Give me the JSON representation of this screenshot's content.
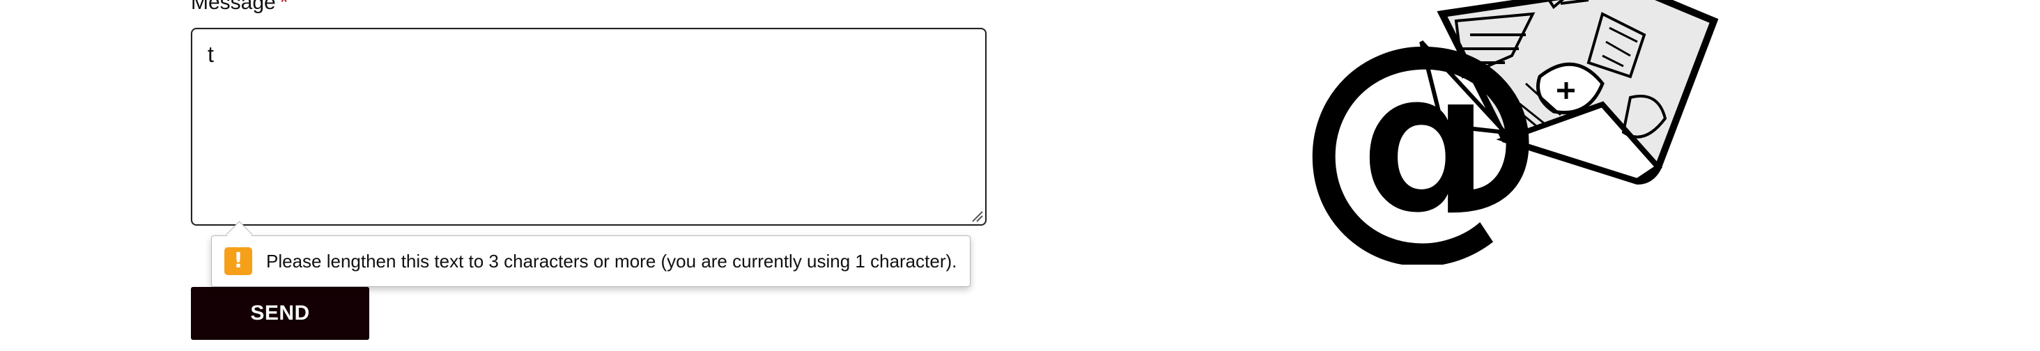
{
  "form": {
    "message_label": "Message",
    "required_marker": "*",
    "message_value": "t",
    "send_label": "SEND"
  },
  "validation": {
    "icon": "warning-icon",
    "icon_glyph": "!",
    "icon_color": "#f6a01a",
    "message": "Please lengthen this text to 3 characters or more (you are currently using 1 character)."
  },
  "illustration": {
    "icon": "at-sign-envelope-doodle",
    "glyph": "@"
  }
}
